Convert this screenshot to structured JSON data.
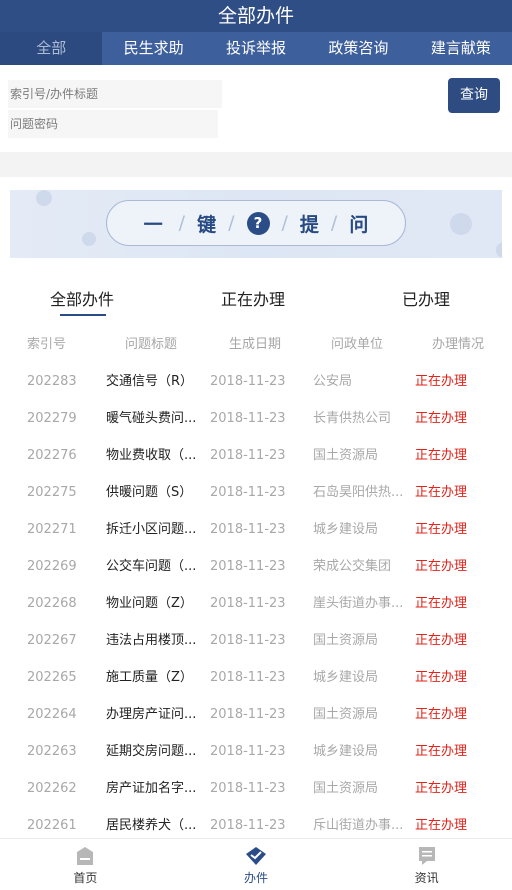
{
  "header": {
    "title": "全部办件"
  },
  "categories": [
    {
      "label": "全部"
    },
    {
      "label": "民生求助"
    },
    {
      "label": "投诉举报"
    },
    {
      "label": "政策咨询"
    },
    {
      "label": "建言献策"
    }
  ],
  "search": {
    "index_placeholder": "索引号/办件标题",
    "password_placeholder": "问题密码",
    "query_label": "查询"
  },
  "banner": {
    "dash": "一",
    "word1": "键",
    "qmark": "?",
    "word2": "提",
    "word3": "问"
  },
  "status_tabs": [
    {
      "label": "全部办件"
    },
    {
      "label": "正在办理"
    },
    {
      "label": "已办理"
    }
  ],
  "table": {
    "headers": {
      "index": "索引号",
      "title": "问题标题",
      "date": "生成日期",
      "unit": "问政单位",
      "status": "办理情况"
    },
    "rows": [
      {
        "index": "202283",
        "title": "交通信号（R）",
        "date": "2018-11-23",
        "unit": "公安局",
        "status": "正在办理"
      },
      {
        "index": "202279",
        "title": "暖气碰头费问...",
        "date": "2018-11-23",
        "unit": "长青供热公司",
        "status": "正在办理"
      },
      {
        "index": "202276",
        "title": "物业费收取（...",
        "date": "2018-11-23",
        "unit": "国土资源局",
        "status": "正在办理"
      },
      {
        "index": "202275",
        "title": "供暖问题（S）",
        "date": "2018-11-23",
        "unit": "石岛昊阳供热...",
        "status": "正在办理"
      },
      {
        "index": "202271",
        "title": "拆迁小区问题...",
        "date": "2018-11-23",
        "unit": "城乡建设局",
        "status": "正在办理"
      },
      {
        "index": "202269",
        "title": "公交车问题（...",
        "date": "2018-11-23",
        "unit": "荣成公交集团",
        "status": "正在办理"
      },
      {
        "index": "202268",
        "title": "物业问题（Z）",
        "date": "2018-11-23",
        "unit": "崖头街道办事...",
        "status": "正在办理"
      },
      {
        "index": "202267",
        "title": "违法占用楼顶...",
        "date": "2018-11-23",
        "unit": "国土资源局",
        "status": "正在办理"
      },
      {
        "index": "202265",
        "title": "施工质量（Z）",
        "date": "2018-11-23",
        "unit": "城乡建设局",
        "status": "正在办理"
      },
      {
        "index": "202264",
        "title": "办理房产证问...",
        "date": "2018-11-23",
        "unit": "国土资源局",
        "status": "正在办理"
      },
      {
        "index": "202263",
        "title": "延期交房问题...",
        "date": "2018-11-23",
        "unit": "城乡建设局",
        "status": "正在办理"
      },
      {
        "index": "202262",
        "title": "房产证加名字...",
        "date": "2018-11-23",
        "unit": "国土资源局",
        "status": "正在办理"
      },
      {
        "index": "202261",
        "title": "居民楼养犬（...",
        "date": "2018-11-23",
        "unit": "斥山街道办事...",
        "status": "正在办理"
      }
    ]
  },
  "bottom_nav": [
    {
      "label": "首页",
      "icon": "home-icon"
    },
    {
      "label": "办件",
      "icon": "shield-check-icon",
      "active": true
    },
    {
      "label": "资讯",
      "icon": "news-icon"
    }
  ],
  "colors": {
    "primary": "#2f4e86",
    "tab_bar": "#3d5f9c",
    "status_red": "#e2231a"
  }
}
